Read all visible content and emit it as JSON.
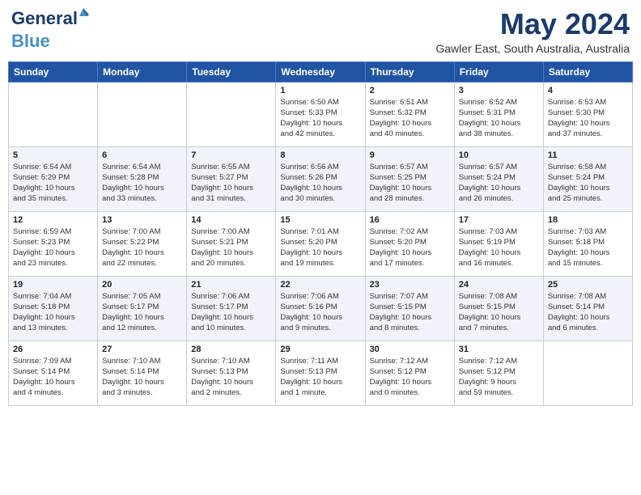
{
  "header": {
    "logo_line1": "General",
    "logo_line2": "Blue",
    "month": "May 2024",
    "location": "Gawler East, South Australia, Australia"
  },
  "days_of_week": [
    "Sunday",
    "Monday",
    "Tuesday",
    "Wednesday",
    "Thursday",
    "Friday",
    "Saturday"
  ],
  "weeks": [
    [
      {
        "day": "",
        "info": ""
      },
      {
        "day": "",
        "info": ""
      },
      {
        "day": "",
        "info": ""
      },
      {
        "day": "1",
        "info": "Sunrise: 6:50 AM\nSunset: 5:33 PM\nDaylight: 10 hours\nand 42 minutes."
      },
      {
        "day": "2",
        "info": "Sunrise: 6:51 AM\nSunset: 5:32 PM\nDaylight: 10 hours\nand 40 minutes."
      },
      {
        "day": "3",
        "info": "Sunrise: 6:52 AM\nSunset: 5:31 PM\nDaylight: 10 hours\nand 38 minutes."
      },
      {
        "day": "4",
        "info": "Sunrise: 6:53 AM\nSunset: 5:30 PM\nDaylight: 10 hours\nand 37 minutes."
      }
    ],
    [
      {
        "day": "5",
        "info": "Sunrise: 6:54 AM\nSunset: 5:29 PM\nDaylight: 10 hours\nand 35 minutes."
      },
      {
        "day": "6",
        "info": "Sunrise: 6:54 AM\nSunset: 5:28 PM\nDaylight: 10 hours\nand 33 minutes."
      },
      {
        "day": "7",
        "info": "Sunrise: 6:55 AM\nSunset: 5:27 PM\nDaylight: 10 hours\nand 31 minutes."
      },
      {
        "day": "8",
        "info": "Sunrise: 6:56 AM\nSunset: 5:26 PM\nDaylight: 10 hours\nand 30 minutes."
      },
      {
        "day": "9",
        "info": "Sunrise: 6:57 AM\nSunset: 5:25 PM\nDaylight: 10 hours\nand 28 minutes."
      },
      {
        "day": "10",
        "info": "Sunrise: 6:57 AM\nSunset: 5:24 PM\nDaylight: 10 hours\nand 26 minutes."
      },
      {
        "day": "11",
        "info": "Sunrise: 6:58 AM\nSunset: 5:24 PM\nDaylight: 10 hours\nand 25 minutes."
      }
    ],
    [
      {
        "day": "12",
        "info": "Sunrise: 6:59 AM\nSunset: 5:23 PM\nDaylight: 10 hours\nand 23 minutes."
      },
      {
        "day": "13",
        "info": "Sunrise: 7:00 AM\nSunset: 5:22 PM\nDaylight: 10 hours\nand 22 minutes."
      },
      {
        "day": "14",
        "info": "Sunrise: 7:00 AM\nSunset: 5:21 PM\nDaylight: 10 hours\nand 20 minutes."
      },
      {
        "day": "15",
        "info": "Sunrise: 7:01 AM\nSunset: 5:20 PM\nDaylight: 10 hours\nand 19 minutes."
      },
      {
        "day": "16",
        "info": "Sunrise: 7:02 AM\nSunset: 5:20 PM\nDaylight: 10 hours\nand 17 minutes."
      },
      {
        "day": "17",
        "info": "Sunrise: 7:03 AM\nSunset: 5:19 PM\nDaylight: 10 hours\nand 16 minutes."
      },
      {
        "day": "18",
        "info": "Sunrise: 7:03 AM\nSunset: 5:18 PM\nDaylight: 10 hours\nand 15 minutes."
      }
    ],
    [
      {
        "day": "19",
        "info": "Sunrise: 7:04 AM\nSunset: 5:18 PM\nDaylight: 10 hours\nand 13 minutes."
      },
      {
        "day": "20",
        "info": "Sunrise: 7:05 AM\nSunset: 5:17 PM\nDaylight: 10 hours\nand 12 minutes."
      },
      {
        "day": "21",
        "info": "Sunrise: 7:06 AM\nSunset: 5:17 PM\nDaylight: 10 hours\nand 10 minutes."
      },
      {
        "day": "22",
        "info": "Sunrise: 7:06 AM\nSunset: 5:16 PM\nDaylight: 10 hours\nand 9 minutes."
      },
      {
        "day": "23",
        "info": "Sunrise: 7:07 AM\nSunset: 5:15 PM\nDaylight: 10 hours\nand 8 minutes."
      },
      {
        "day": "24",
        "info": "Sunrise: 7:08 AM\nSunset: 5:15 PM\nDaylight: 10 hours\nand 7 minutes."
      },
      {
        "day": "25",
        "info": "Sunrise: 7:08 AM\nSunset: 5:14 PM\nDaylight: 10 hours\nand 6 minutes."
      }
    ],
    [
      {
        "day": "26",
        "info": "Sunrise: 7:09 AM\nSunset: 5:14 PM\nDaylight: 10 hours\nand 4 minutes."
      },
      {
        "day": "27",
        "info": "Sunrise: 7:10 AM\nSunset: 5:14 PM\nDaylight: 10 hours\nand 3 minutes."
      },
      {
        "day": "28",
        "info": "Sunrise: 7:10 AM\nSunset: 5:13 PM\nDaylight: 10 hours\nand 2 minutes."
      },
      {
        "day": "29",
        "info": "Sunrise: 7:11 AM\nSunset: 5:13 PM\nDaylight: 10 hours\nand 1 minute."
      },
      {
        "day": "30",
        "info": "Sunrise: 7:12 AM\nSunset: 5:12 PM\nDaylight: 10 hours\nand 0 minutes."
      },
      {
        "day": "31",
        "info": "Sunrise: 7:12 AM\nSunset: 5:12 PM\nDaylight: 9 hours\nand 59 minutes."
      },
      {
        "day": "",
        "info": ""
      }
    ]
  ]
}
